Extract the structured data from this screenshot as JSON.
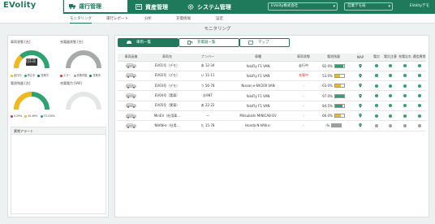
{
  "app": {
    "logo": "EVolity"
  },
  "colors": {
    "brand": "#1f7a5c",
    "green": "#2ea36f",
    "yellow": "#f2b91f",
    "gray": "#9aa1a1",
    "red": "#d6332e",
    "teal": "#1f7a5c"
  },
  "header": {
    "tabs": [
      {
        "label": "運行管理",
        "icon": "truck-icon",
        "active": true
      },
      {
        "label": "資産管理",
        "icon": "building-icon",
        "active": false
      },
      {
        "label": "システム管理",
        "icon": "gear-icon",
        "active": false
      }
    ],
    "company_select": "EVolity株式会社",
    "org_select": "営業デモ局",
    "user": "EVolityデモ"
  },
  "subnav": [
    "モニタリング",
    "運行レポート",
    "分析",
    "充電情報",
    "設定"
  ],
  "page_title": "モニタリング",
  "left": {
    "vehicle_status_title": "車両状態 [台]",
    "vehicle_status_center": [
      "走行中 1台",
      "停止中 5台"
    ],
    "vehicle_status_legend": [
      "走行中",
      "停止中",
      "充電中"
    ],
    "charger_status_title": "充電器状態 [台]",
    "charger_status_legend": [
      "エラー",
      "充電可能",
      "充電中"
    ],
    "battery_title": "電池残量 [台]",
    "battery_legend": [
      "0-29%",
      "30-69%",
      "70-100%"
    ],
    "charge_power_title": "充電電力 [kW]",
    "alert_title": "異常アラート"
  },
  "right": {
    "tabs": [
      {
        "label": "車両一覧",
        "icon": "car-icon",
        "active": true
      },
      {
        "label": "充電器一覧",
        "icon": "charger-icon",
        "active": false
      },
      {
        "label": "マップ",
        "icon": "map-icon",
        "active": false
      }
    ],
    "columns": [
      "車両画像",
      "車両名",
      "ナンバー",
      "車種",
      "車両状態",
      "電池残量",
      "MAP",
      "電欠",
      "電欠注意",
      "充電忘れ",
      "通信異常"
    ],
    "rows": [
      {
        "name": "EV01号（デモ）",
        "number": "あ 12-34",
        "model": "foloFly F1 VAN",
        "status": "走行中",
        "battery": "92.0%",
        "battery_level": 92,
        "bar_color": "#2ea36f",
        "status_red": false,
        "dot": [
          "#2ea36f",
          "#2ea36f",
          "#2ea36f",
          "#2ea36f"
        ]
      },
      {
        "name": "EV02号（デモ）",
        "number": "い 11-11",
        "model": "foloFly F1 VAN",
        "status": "充電中",
        "battery": "53.0%",
        "battery_level": 53,
        "bar_color": "#f2b91f",
        "status_red": true,
        "dot": [
          "#2ea36f",
          "#2ea36f",
          "#2ea36f",
          "#2ea36f"
        ]
      },
      {
        "name": "EV03号（デモ）",
        "number": "う 56-78",
        "model": "Nissan e-NV200 VAN",
        "status": "-",
        "battery": "63.0%",
        "battery_level": 63,
        "bar_color": "#f2b91f",
        "status_red": false,
        "dot": [
          "#2ea36f",
          "#2ea36f",
          "#2ea36f",
          "#2ea36f"
        ]
      },
      {
        "name": "EV04号（実車）",
        "number": "お987",
        "model": "foloFly F1 VAN",
        "status": "-",
        "battery": "97.0%",
        "battery_level": 97,
        "bar_color": "#2ea36f",
        "status_red": false,
        "dot": [
          "#2ea36f",
          "#2ea36f",
          "#2ea36f",
          "#2ea36f"
        ]
      },
      {
        "name": "EV05号（実車）",
        "number": "あ 22-22",
        "model": "foloFly F1 VAN",
        "status": "-",
        "battery": "84.5%",
        "battery_level": 84.5,
        "bar_color": "#2ea36f",
        "status_red": false,
        "dot": [
          "#2ea36f",
          "#2ea36f",
          "#2ea36f",
          "#2ea36f"
        ]
      },
      {
        "name": "MinEV（社用車…",
        "number": "ー",
        "model": "Mitsubishi MINICAB-EV",
        "status": "-",
        "battery": "66.0%",
        "battery_level": 66,
        "bar_color": "#f2b91f",
        "status_red": false,
        "dot": [
          "#2ea36f",
          "#2ea36f",
          "#2ea36f",
          "#2ea36f"
        ]
      },
      {
        "name": "NVAN-e（社用…",
        "number": "た 15-78",
        "model": "Honda N-VAN e:",
        "status": "-",
        "battery": "-%",
        "battery_level": 0,
        "bar_color": "#9aa1a1",
        "status_red": false,
        "dot": [
          "#9aa1a1",
          "#9aa1a1",
          "#9aa1a1",
          "#9aa1a1"
        ]
      }
    ]
  }
}
